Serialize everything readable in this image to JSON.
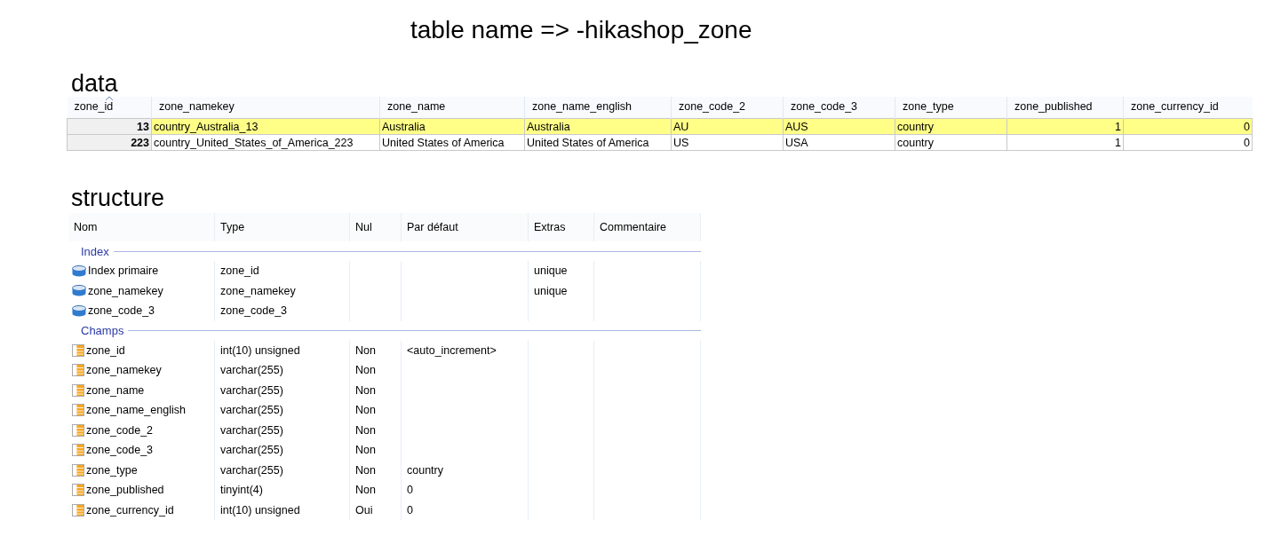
{
  "title": "table name =>  -hikashop_zone",
  "data_section": {
    "heading": "data",
    "columns": [
      {
        "label": "zone_id",
        "sorted": true
      },
      {
        "label": "zone_namekey",
        "sorted": false
      },
      {
        "label": "zone_name",
        "sorted": false
      },
      {
        "label": "zone_name_english",
        "sorted": false
      },
      {
        "label": "zone_code_2",
        "sorted": false
      },
      {
        "label": "zone_code_3",
        "sorted": false
      },
      {
        "label": "zone_type",
        "sorted": false
      },
      {
        "label": "zone_published",
        "sorted": false
      },
      {
        "label": "zone_currency_id",
        "sorted": false
      }
    ],
    "rows": [
      {
        "selected": true,
        "cells": [
          "13",
          "country_Australia_13",
          "Australia",
          "Australia",
          "AU",
          "AUS",
          "country",
          "1",
          "0"
        ]
      },
      {
        "selected": false,
        "cells": [
          "223",
          "country_United_States_of_America_223",
          "United States of America",
          "United States of America",
          "US",
          "USA",
          "country",
          "1",
          "0"
        ]
      }
    ]
  },
  "structure_section": {
    "heading": "structure",
    "columns": [
      "Nom",
      "Type",
      "Nul",
      "Par défaut",
      "Extras",
      "Commentaire"
    ],
    "groups": [
      {
        "label": "Index",
        "kind": "index",
        "rows": [
          [
            "Index primaire",
            "zone_id",
            "",
            "",
            "unique",
            ""
          ],
          [
            "zone_namekey",
            "zone_namekey",
            "",
            "",
            "unique",
            ""
          ],
          [
            "zone_code_3",
            "zone_code_3",
            "",
            "",
            "",
            ""
          ]
        ]
      },
      {
        "label": "Champs",
        "kind": "field",
        "rows": [
          [
            "zone_id",
            "int(10) unsigned",
            "Non",
            "<auto_increment>",
            "",
            ""
          ],
          [
            "zone_namekey",
            "varchar(255)",
            "Non",
            "",
            "",
            ""
          ],
          [
            "zone_name",
            "varchar(255)",
            "Non",
            "",
            "",
            ""
          ],
          [
            "zone_name_english",
            "varchar(255)",
            "Non",
            "",
            "",
            ""
          ],
          [
            "zone_code_2",
            "varchar(255)",
            "Non",
            "",
            "",
            ""
          ],
          [
            "zone_code_3",
            "varchar(255)",
            "Non",
            "",
            "",
            ""
          ],
          [
            "zone_type",
            "varchar(255)",
            "Non",
            "country",
            "",
            ""
          ],
          [
            "zone_published",
            "tinyint(4)",
            "Non",
            "0",
            "",
            ""
          ],
          [
            "zone_currency_id",
            "int(10) unsigned",
            "Oui",
            "0",
            "",
            ""
          ]
        ]
      }
    ]
  }
}
